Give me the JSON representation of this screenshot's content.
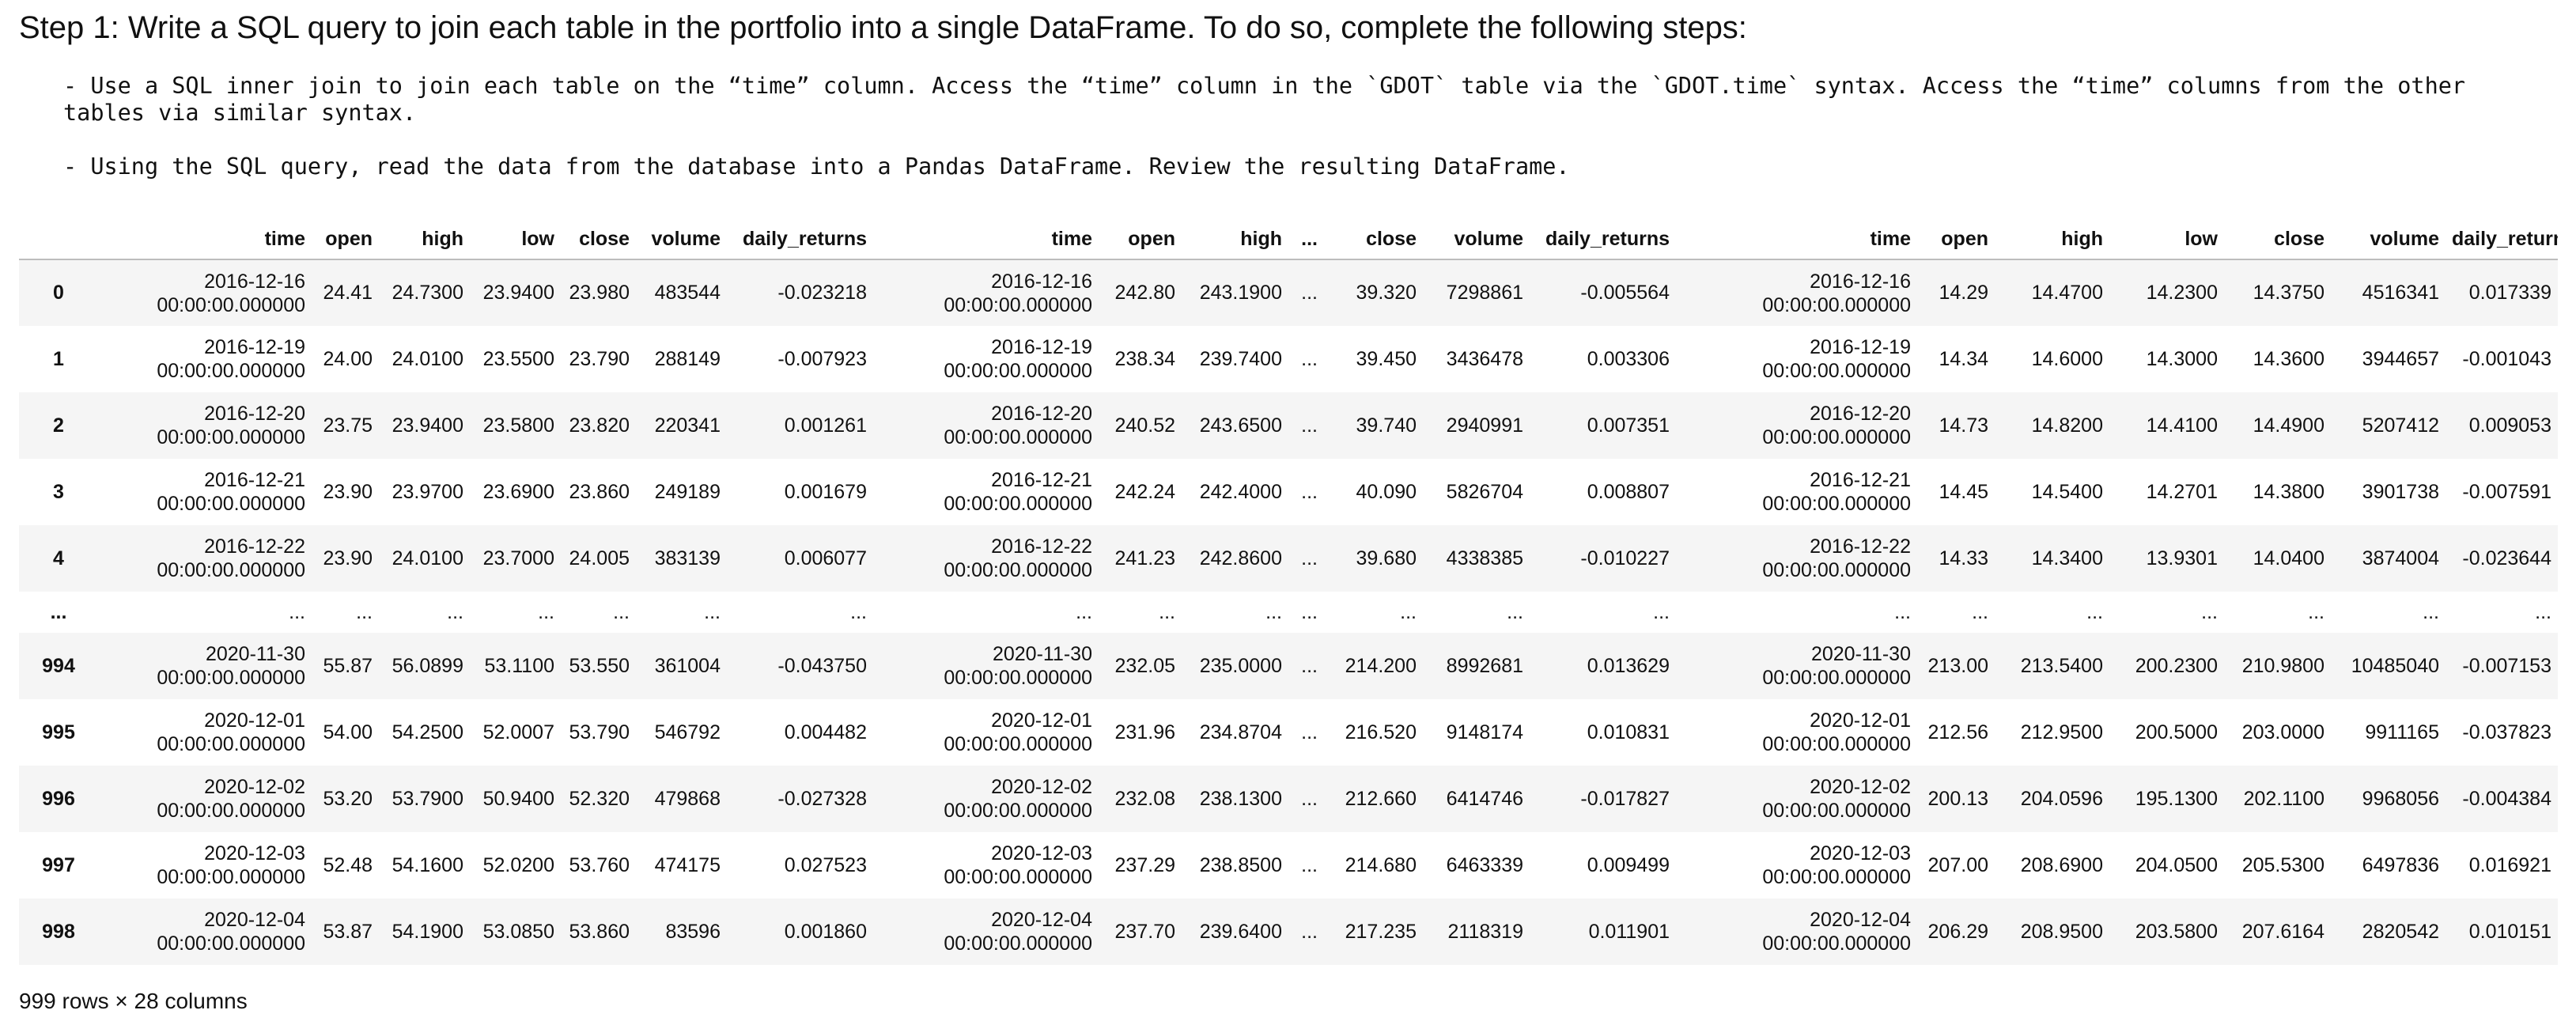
{
  "heading": "Step 1: Write a SQL query to join each table in the portfolio into a single DataFrame. To do so, complete the following steps:",
  "bullets": [
    "- Use a SQL inner join to join each table on the “time” column. Access the “time” column in the `GDOT` table via the `GDOT.time` syntax. Access the “time” columns from the other tables via similar syntax.",
    "- Using the SQL query, read the data from the database into a Pandas DataFrame. Review the resulting DataFrame."
  ],
  "table": {
    "columns": [
      "",
      "time",
      "open",
      "high",
      "low",
      "close",
      "volume",
      "daily_returns",
      "time",
      "open",
      "high",
      "...",
      "close",
      "volume",
      "daily_returns",
      "time",
      "open",
      "high",
      "low",
      "close",
      "volume",
      "daily_returns"
    ],
    "rows": [
      {
        "index": "0",
        "cells": [
          [
            "2016-12-16",
            "00:00:00.000000"
          ],
          "24.41",
          "24.7300",
          "23.9400",
          "23.980",
          "483544",
          "-0.023218",
          [
            "2016-12-16",
            "00:00:00.000000"
          ],
          "242.80",
          "243.1900",
          "...",
          "39.320",
          "7298861",
          "-0.005564",
          [
            "2016-12-16",
            "00:00:00.000000"
          ],
          "14.29",
          "14.4700",
          "14.2300",
          "14.3750",
          "4516341",
          "0.017339"
        ]
      },
      {
        "index": "1",
        "cells": [
          [
            "2016-12-19",
            "00:00:00.000000"
          ],
          "24.00",
          "24.0100",
          "23.5500",
          "23.790",
          "288149",
          "-0.007923",
          [
            "2016-12-19",
            "00:00:00.000000"
          ],
          "238.34",
          "239.7400",
          "...",
          "39.450",
          "3436478",
          "0.003306",
          [
            "2016-12-19",
            "00:00:00.000000"
          ],
          "14.34",
          "14.6000",
          "14.3000",
          "14.3600",
          "3944657",
          "-0.001043"
        ]
      },
      {
        "index": "2",
        "cells": [
          [
            "2016-12-20",
            "00:00:00.000000"
          ],
          "23.75",
          "23.9400",
          "23.5800",
          "23.820",
          "220341",
          "0.001261",
          [
            "2016-12-20",
            "00:00:00.000000"
          ],
          "240.52",
          "243.6500",
          "...",
          "39.740",
          "2940991",
          "0.007351",
          [
            "2016-12-20",
            "00:00:00.000000"
          ],
          "14.73",
          "14.8200",
          "14.4100",
          "14.4900",
          "5207412",
          "0.009053"
        ]
      },
      {
        "index": "3",
        "cells": [
          [
            "2016-12-21",
            "00:00:00.000000"
          ],
          "23.90",
          "23.9700",
          "23.6900",
          "23.860",
          "249189",
          "0.001679",
          [
            "2016-12-21",
            "00:00:00.000000"
          ],
          "242.24",
          "242.4000",
          "...",
          "40.090",
          "5826704",
          "0.008807",
          [
            "2016-12-21",
            "00:00:00.000000"
          ],
          "14.45",
          "14.5400",
          "14.2701",
          "14.3800",
          "3901738",
          "-0.007591"
        ]
      },
      {
        "index": "4",
        "cells": [
          [
            "2016-12-22",
            "00:00:00.000000"
          ],
          "23.90",
          "24.0100",
          "23.7000",
          "24.005",
          "383139",
          "0.006077",
          [
            "2016-12-22",
            "00:00:00.000000"
          ],
          "241.23",
          "242.8600",
          "...",
          "39.680",
          "4338385",
          "-0.010227",
          [
            "2016-12-22",
            "00:00:00.000000"
          ],
          "14.33",
          "14.3400",
          "13.9301",
          "14.0400",
          "3874004",
          "-0.023644"
        ]
      },
      {
        "index": "...",
        "ellipsis": true,
        "cells": [
          "...",
          "...",
          "...",
          "...",
          "...",
          "...",
          "...",
          "...",
          "...",
          "...",
          "...",
          "...",
          "...",
          "...",
          "...",
          "...",
          "...",
          "...",
          "...",
          "...",
          "..."
        ]
      },
      {
        "index": "994",
        "cells": [
          [
            "2020-11-30",
            "00:00:00.000000"
          ],
          "55.87",
          "56.0899",
          "53.1100",
          "53.550",
          "361004",
          "-0.043750",
          [
            "2020-11-30",
            "00:00:00.000000"
          ],
          "232.05",
          "235.0000",
          "...",
          "214.200",
          "8992681",
          "0.013629",
          [
            "2020-11-30",
            "00:00:00.000000"
          ],
          "213.00",
          "213.5400",
          "200.2300",
          "210.9800",
          "10485040",
          "-0.007153"
        ]
      },
      {
        "index": "995",
        "cells": [
          [
            "2020-12-01",
            "00:00:00.000000"
          ],
          "54.00",
          "54.2500",
          "52.0007",
          "53.790",
          "546792",
          "0.004482",
          [
            "2020-12-01",
            "00:00:00.000000"
          ],
          "231.96",
          "234.8704",
          "...",
          "216.520",
          "9148174",
          "0.010831",
          [
            "2020-12-01",
            "00:00:00.000000"
          ],
          "212.56",
          "212.9500",
          "200.5000",
          "203.0000",
          "9911165",
          "-0.037823"
        ]
      },
      {
        "index": "996",
        "cells": [
          [
            "2020-12-02",
            "00:00:00.000000"
          ],
          "53.20",
          "53.7900",
          "50.9400",
          "52.320",
          "479868",
          "-0.027328",
          [
            "2020-12-02",
            "00:00:00.000000"
          ],
          "232.08",
          "238.1300",
          "...",
          "212.660",
          "6414746",
          "-0.017827",
          [
            "2020-12-02",
            "00:00:00.000000"
          ],
          "200.13",
          "204.0596",
          "195.1300",
          "202.1100",
          "9968056",
          "-0.004384"
        ]
      },
      {
        "index": "997",
        "cells": [
          [
            "2020-12-03",
            "00:00:00.000000"
          ],
          "52.48",
          "54.1600",
          "52.0200",
          "53.760",
          "474175",
          "0.027523",
          [
            "2020-12-03",
            "00:00:00.000000"
          ],
          "237.29",
          "238.8500",
          "...",
          "214.680",
          "6463339",
          "0.009499",
          [
            "2020-12-03",
            "00:00:00.000000"
          ],
          "207.00",
          "208.6900",
          "204.0500",
          "205.5300",
          "6497836",
          "0.016921"
        ]
      },
      {
        "index": "998",
        "cells": [
          [
            "2020-12-04",
            "00:00:00.000000"
          ],
          "53.87",
          "54.1900",
          "53.0850",
          "53.860",
          "83596",
          "0.001860",
          [
            "2020-12-04",
            "00:00:00.000000"
          ],
          "237.70",
          "239.6400",
          "...",
          "217.235",
          "2118319",
          "0.011901",
          [
            "2020-12-04",
            "00:00:00.000000"
          ],
          "206.29",
          "208.9500",
          "203.5800",
          "207.6164",
          "2820542",
          "0.010151"
        ]
      }
    ]
  },
  "footer": "999 rows × 28 columns"
}
